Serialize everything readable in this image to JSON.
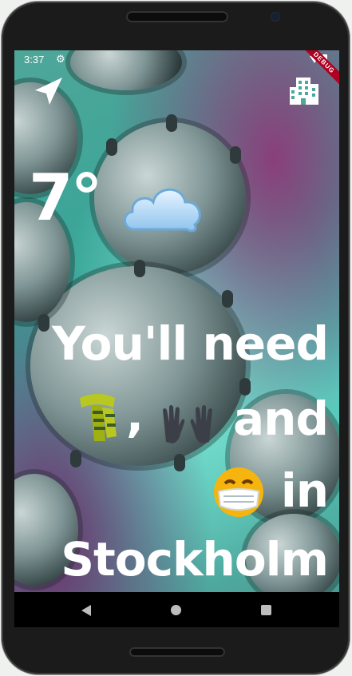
{
  "status_bar": {
    "time": "3:37",
    "debug_banner": "DEBUG"
  },
  "icons": {
    "navigation": "navigation-arrow-icon",
    "city": "city-buildings-icon",
    "cloud": "cloud-emoji",
    "scarf": "scarf-emoji",
    "gloves": "gloves-emoji",
    "mask": "face-with-medical-mask-emoji"
  },
  "weather": {
    "temperature": "7°"
  },
  "message": {
    "line1": "You'll need",
    "line2_sep": ",",
    "line2_word": "and",
    "line3_word": "in",
    "city": "Stockholm"
  },
  "colors": {
    "text": "#ffffff",
    "debug": "#b00020"
  }
}
